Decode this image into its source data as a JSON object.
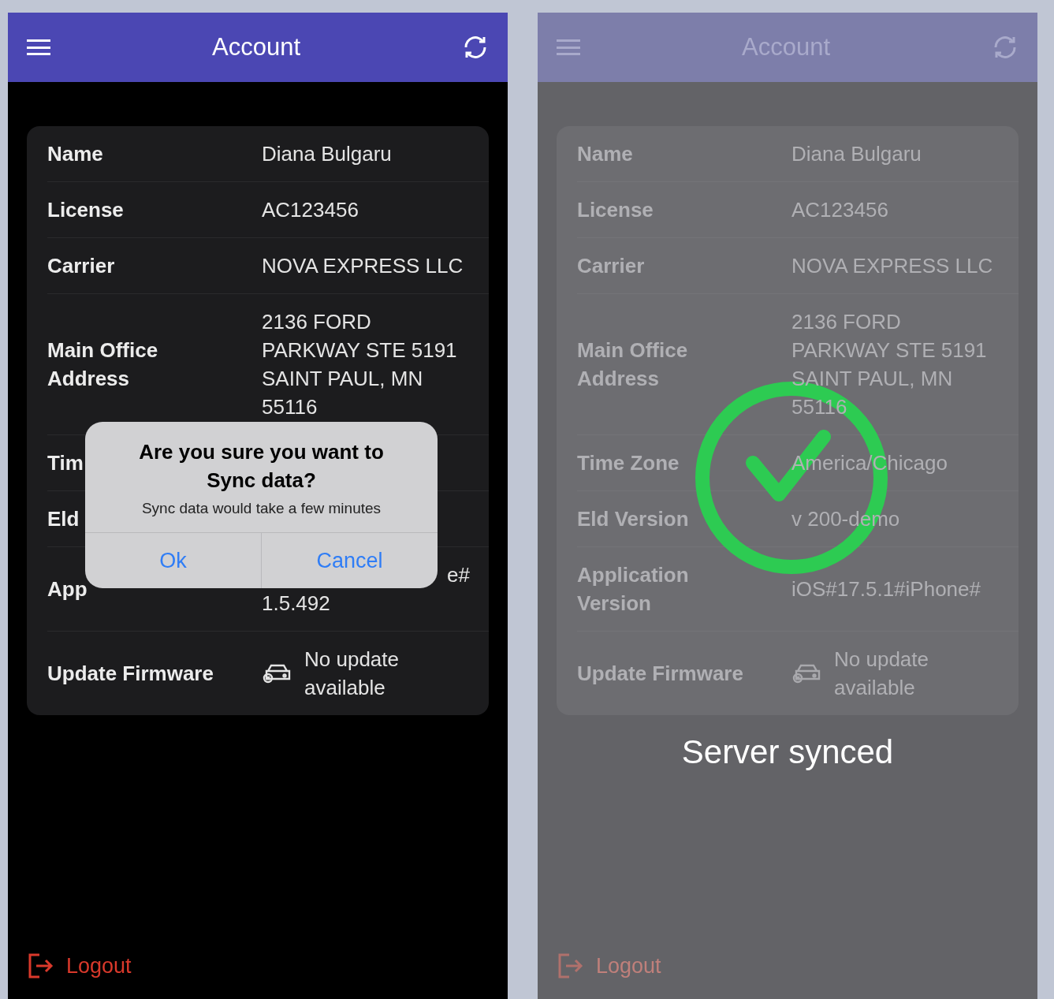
{
  "screens": [
    {
      "kind": "confirm",
      "header": {
        "title": "Account"
      },
      "rows": [
        {
          "kind": "text",
          "label": "Name",
          "lines": [
            "Diana Bulgaru"
          ]
        },
        {
          "kind": "text",
          "label": "License",
          "lines": [
            "AC123456"
          ]
        },
        {
          "kind": "text",
          "label": "Carrier",
          "lines": [
            "NOVA EXPRESS LLC"
          ]
        },
        {
          "kind": "text",
          "label": "Main Office Address",
          "lines": [
            "2136 FORD",
            "PARKWAY STE 5191",
            "SAINT PAUL, MN",
            "55116"
          ]
        },
        {
          "kind": "text",
          "label": "Tim",
          "lines": []
        },
        {
          "kind": "text",
          "label": "Eld",
          "lines": []
        },
        {
          "kind": "partial",
          "label": "App",
          "lines": [
            "e#",
            "1.5.492"
          ]
        },
        {
          "kind": "firmware",
          "label": "Update Firmware",
          "lines": [
            "No update",
            "available"
          ]
        }
      ],
      "dialog": {
        "title": "Are you sure you want to Sync data?",
        "message": "Sync data would take a few minutes",
        "buttons": [
          "Ok",
          "Cancel"
        ]
      },
      "logout": "Logout"
    },
    {
      "kind": "synced",
      "header": {
        "title": "Account"
      },
      "rows": [
        {
          "kind": "text",
          "label": "Name",
          "lines": [
            "Diana Bulgaru"
          ]
        },
        {
          "kind": "text",
          "label": "License",
          "lines": [
            "AC123456"
          ]
        },
        {
          "kind": "text",
          "label": "Carrier",
          "lines": [
            "NOVA EXPRESS LLC"
          ]
        },
        {
          "kind": "text",
          "label": "Main Office Address",
          "lines": [
            "2136 FORD",
            "PARKWAY STE 5191",
            "SAINT PAUL, MN",
            "55116"
          ]
        },
        {
          "kind": "text",
          "label": "Time Zone",
          "lines": [
            "America/Chicago"
          ]
        },
        {
          "kind": "text",
          "label": "Eld Version",
          "lines": [
            "v 200-demo"
          ]
        },
        {
          "kind": "text",
          "label": "Application Version",
          "lines": [
            "iOS#17.5.1#iPhone#"
          ]
        },
        {
          "kind": "firmware",
          "label": "Update Firmware",
          "lines": [
            "No update",
            "available"
          ]
        }
      ],
      "toast": "Server synced",
      "logout": "Logout"
    }
  ]
}
